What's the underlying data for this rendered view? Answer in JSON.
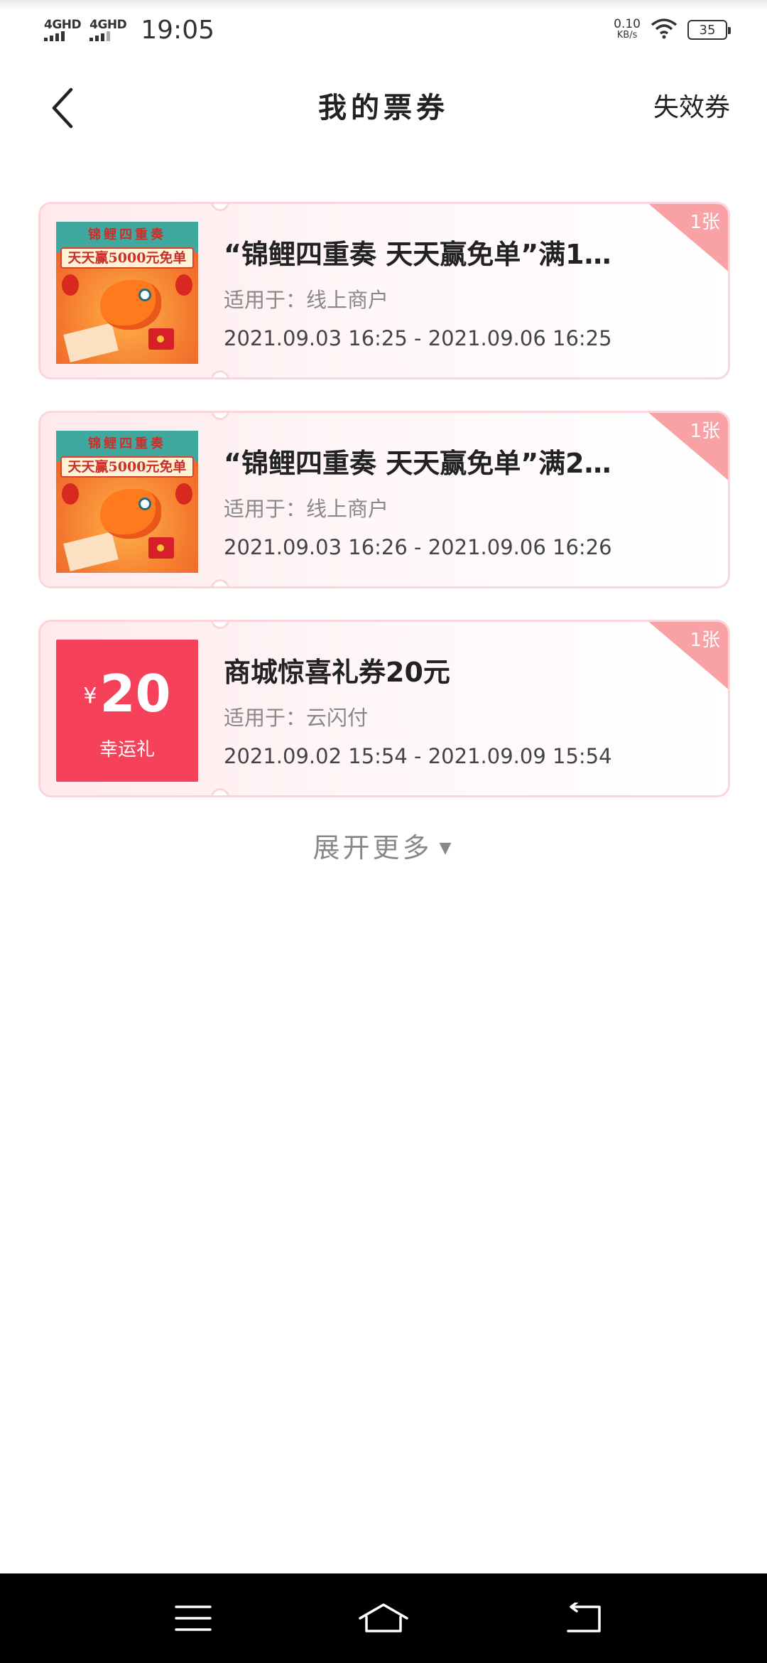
{
  "status_bar": {
    "sim1": "4GHD",
    "sim2": "4GHD",
    "time": "19:05",
    "net_speed_value": "0.10",
    "net_speed_unit": "KB/s",
    "battery": "35"
  },
  "header": {
    "title": "我的票券",
    "expired_link": "失效券"
  },
  "coupons": [
    {
      "thumb_type": "banner",
      "thumb_line1": "锦鲤四重奏",
      "thumb_line2": "天天赢5000元免单",
      "title": "“锦鲤四重奏 天天赢免单”满1…",
      "scope": "适用于：线上商户",
      "period": "2021.09.03 16:25 - 2021.09.06 16:25",
      "count": "1张"
    },
    {
      "thumb_type": "banner",
      "thumb_line1": "锦鲤四重奏",
      "thumb_line2": "天天赢5000元免单",
      "title": "“锦鲤四重奏 天天赢免单”满2…",
      "scope": "适用于：线上商户",
      "period": "2021.09.03 16:26 - 2021.09.06 16:26",
      "count": "1张"
    },
    {
      "thumb_type": "money",
      "thumb_currency": "¥",
      "thumb_amount": "20",
      "thumb_label": "幸运礼",
      "title": "商城惊喜礼券20元",
      "scope": "适用于：云闪付",
      "period": "2021.09.02 15:54 - 2021.09.09 15:54",
      "count": "1张"
    }
  ],
  "expand_more": {
    "label": "展开更多",
    "icon": "triangle-down-icon"
  },
  "nav_bar": {
    "menu_icon": "menu-icon",
    "home_icon": "home-icon",
    "back_icon": "return-icon"
  },
  "colors": {
    "accent_red": "#f5415a",
    "badge_pink": "#f9a2a6",
    "card_border": "#fbd5da"
  }
}
